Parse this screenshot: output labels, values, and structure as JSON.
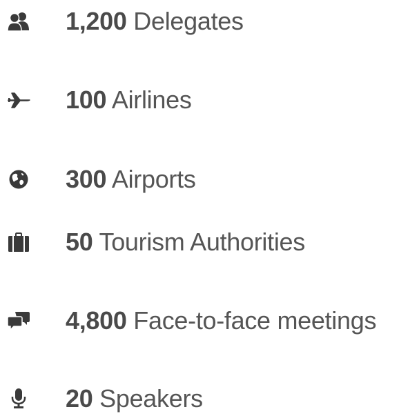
{
  "stats": [
    {
      "icon": "users-icon",
      "number": "1,200",
      "label": "Delegates"
    },
    {
      "icon": "airplane-icon",
      "number": "100",
      "label": "Airlines"
    },
    {
      "icon": "globe-icon",
      "number": "300",
      "label": "Airports"
    },
    {
      "icon": "briefcase-icon",
      "number": "50",
      "label": "Tourism Authorities"
    },
    {
      "icon": "chat-bubbles-icon",
      "number": "4,800",
      "label": "Face-to-face meetings"
    },
    {
      "icon": "microphone-icon",
      "number": "20",
      "label": "Speakers"
    }
  ],
  "colors": {
    "text": "#555555",
    "number": "#4a4a4a",
    "icon": "#3a3a3a"
  }
}
